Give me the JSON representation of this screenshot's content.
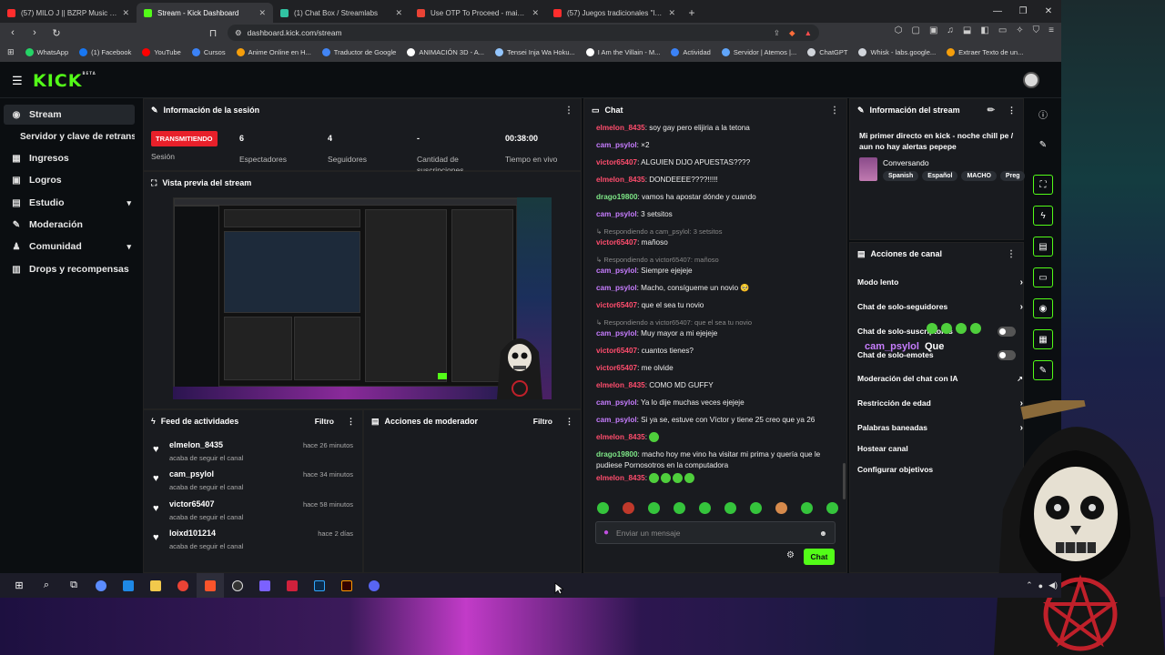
{
  "tabs": [
    {
      "title": "(57) MILO J || BZRP Music Session",
      "color": "#ff2d2d",
      "active": false
    },
    {
      "title": "Stream - Kick Dashboard",
      "color": "#53fc18",
      "active": true
    },
    {
      "title": "(1) Chat Box / Streamlabs",
      "color": "#31c3a2",
      "active": false
    },
    {
      "title": "Use OTP To Proceed - maicolvg.2002",
      "color": "#ea4335",
      "active": false
    },
    {
      "title": "(57) Juegos tradicionales \"los yases\"",
      "color": "#ff2d2d",
      "active": false
    }
  ],
  "address": {
    "url": "dashboard.kick.com/stream"
  },
  "bookmarks": [
    {
      "label": "WhatsApp",
      "color": "#25d366"
    },
    {
      "label": "(1) Facebook",
      "color": "#1877f2"
    },
    {
      "label": "YouTube",
      "color": "#ff0000"
    },
    {
      "label": "Cursos",
      "color": "#3b82f6"
    },
    {
      "label": "Anime Online en H...",
      "color": "#f59e0b"
    },
    {
      "label": "Traductor de Google",
      "color": "#4285f4"
    },
    {
      "label": "ANIMACIÓN 3D - A...",
      "color": "#ffffff"
    },
    {
      "label": "Tensei Inja Wa Hoku...",
      "color": "#93c5fd"
    },
    {
      "label": "I Am the Villain - M...",
      "color": "#ffffff"
    },
    {
      "label": "Actividad",
      "color": "#3b82f6"
    },
    {
      "label": "Servidor | Atemos |...",
      "color": "#60a5fa"
    },
    {
      "label": "ChatGPT",
      "color": "#d1d5db"
    },
    {
      "label": "Whisk - labs.google...",
      "color": "#d1d5db"
    },
    {
      "label": "Extraer Texto de un...",
      "color": "#f59e0b"
    }
  ],
  "brand": {
    "logo": "KICK",
    "beta": "BETA",
    "accent": "#53fc18"
  },
  "sidebar": {
    "items": [
      {
        "label": "Stream",
        "icon": "broadcast-icon",
        "glyph": "◉"
      },
      {
        "label": "Servidor y clave de retransmisión",
        "icon": "",
        "glyph": ""
      },
      {
        "label": "Ingresos",
        "icon": "chart-icon",
        "glyph": "▦"
      },
      {
        "label": "Logros",
        "icon": "achievement-icon",
        "glyph": "▣"
      },
      {
        "label": "Estudio",
        "icon": "studio-icon",
        "glyph": "▤"
      },
      {
        "label": "Moderación",
        "icon": "wrench-icon",
        "glyph": "✎"
      },
      {
        "label": "Comunidad",
        "icon": "community-icon",
        "glyph": "♟"
      },
      {
        "label": "Drops y recompensas",
        "icon": "drops-icon",
        "glyph": "▥"
      }
    ]
  },
  "session": {
    "title": "Información de la sesión",
    "status": "TRANSMITIENDO",
    "status_label": "Sesión",
    "viewers_value": "6",
    "viewers_label": "Espectadores",
    "followers_value": "4",
    "followers_label": "Seguidores",
    "subs_value": "-",
    "subs_label": "Cantidad de suscripciones",
    "time_value": "00:38:00",
    "time_label": "Tiempo en vivo"
  },
  "preview": {
    "title": "Vista previa del stream"
  },
  "activity": {
    "title": "Feed de actividades",
    "filter": "Filtro",
    "items": [
      {
        "name": "elmelon_8435",
        "sub": "acaba de seguir el canal",
        "time": "hace 26 minutos"
      },
      {
        "name": "cam_psylol",
        "sub": "acaba de seguir el canal",
        "time": "hace 34 minutos"
      },
      {
        "name": "victor65407",
        "sub": "acaba de seguir el canal",
        "time": "hace 58 minutos"
      },
      {
        "name": "loixd101214",
        "sub": "acaba de seguir el canal",
        "time": "hace 2 días"
      }
    ]
  },
  "modactions": {
    "title": "Acciones de moderador",
    "filter": "Filtro"
  },
  "chat": {
    "title": "Chat",
    "placeholder": "Enviar un mensaje",
    "send": "Chat",
    "messages": [
      {
        "user": "elmelon_8435",
        "color": "#ff4d6d",
        "text": ": soy gay pero elijiria a la tetona"
      },
      {
        "user": "cam_psylol",
        "color": "#c77dff",
        "text": ": ×2"
      },
      {
        "user": "victor65407",
        "color": "#ff4d6d",
        "text": ": ALGUIEN DIJO APUESTAS????"
      },
      {
        "user": "elmelon_8435",
        "color": "#ff4d6d",
        "text": ": DONDEEEE????!!!!!"
      },
      {
        "user": "drago19800",
        "color": "#7ee787",
        "text": ": vamos ha apostar dónde y cuando"
      },
      {
        "user": "cam_psylol",
        "color": "#c77dff",
        "text": ": 3 setsitos"
      },
      {
        "reply": "Respondiendo a cam_psylol: 3 setsitos"
      },
      {
        "user": "victor65407",
        "color": "#ff4d6d",
        "text": ": mañoso"
      },
      {
        "reply": "Respondiendo a victor65407: mañoso"
      },
      {
        "user": "cam_psylol",
        "color": "#c77dff",
        "text": ": Siempre ejejeje"
      },
      {
        "user": "cam_psylol",
        "color": "#c77dff",
        "text": ": Macho, consígueme un novio 🥺"
      },
      {
        "user": "victor65407",
        "color": "#ff4d6d",
        "text": ": que el sea tu novio"
      },
      {
        "reply": "Respondiendo a victor65407: que el sea tu novio"
      },
      {
        "user": "cam_psylol",
        "color": "#c77dff",
        "text": ": Muy mayor a mi ejejeje"
      },
      {
        "user": "victor65407",
        "color": "#ff4d6d",
        "text": ": cuantos tienes?"
      },
      {
        "user": "victor65407",
        "color": "#ff4d6d",
        "text": ": me olvide"
      },
      {
        "user": "elmelon_8435",
        "color": "#ff4d6d",
        "text": ": COMO MD GUFFY"
      },
      {
        "user": "cam_psylol",
        "color": "#c77dff",
        "text": ": Ya lo dije muchas veces ejejeje"
      },
      {
        "user": "cam_psylol",
        "color": "#c77dff",
        "text": ": Si ya se, estuve con Víctor y tiene 25 creo que ya 26"
      },
      {
        "user": "elmelon_8435",
        "color": "#ff4d6d",
        "text": ": "
      },
      {
        "user": "drago19800",
        "color": "#7ee787",
        "text": ": macho hoy me vino ha visitar mi prima y quería que le pudiese Pornosotros en la computadora"
      },
      {
        "user": "elmelon_8435",
        "color": "#ff4d6d",
        "text": ": "
      },
      {
        "user": "cam_psylol",
        "color": "#c77dff",
        "text": ": Que"
      }
    ]
  },
  "streaminfo": {
    "title": "Información del stream",
    "stream_title": "Mi primer directo en kick - noche chill pe / aun no hay alertas pepepe",
    "category": "Conversando",
    "tags": [
      "Spanish",
      "Español",
      "MACHO",
      "Preg"
    ]
  },
  "channel": {
    "title": "Acciones de canal",
    "items": [
      {
        "label": "Modo lento",
        "kind": "chevron"
      },
      {
        "label": "Chat de solo-seguidores",
        "kind": "chevron"
      },
      {
        "label": "Chat de solo-suscriptores",
        "kind": "toggle"
      },
      {
        "label": "Chat de solo-emotes",
        "kind": "toggle"
      },
      {
        "label": "Moderación del chat con IA",
        "kind": "external"
      },
      {
        "label": "Restricción de edad",
        "kind": "chevron"
      },
      {
        "label": "Palabras baneadas",
        "kind": "chevron"
      },
      {
        "label": "Hostear canal",
        "kind": "none"
      },
      {
        "label": "Configurar objetivos",
        "kind": "none"
      }
    ]
  },
  "overlay": {
    "name": "cam_psylol",
    "message": "Que"
  },
  "rail": [
    "info-icon",
    "pencil-icon",
    "crop-icon",
    "bolt-icon",
    "notes-icon",
    "chat-icon",
    "broadcast-icon",
    "server-icon",
    "wrench-icon"
  ]
}
